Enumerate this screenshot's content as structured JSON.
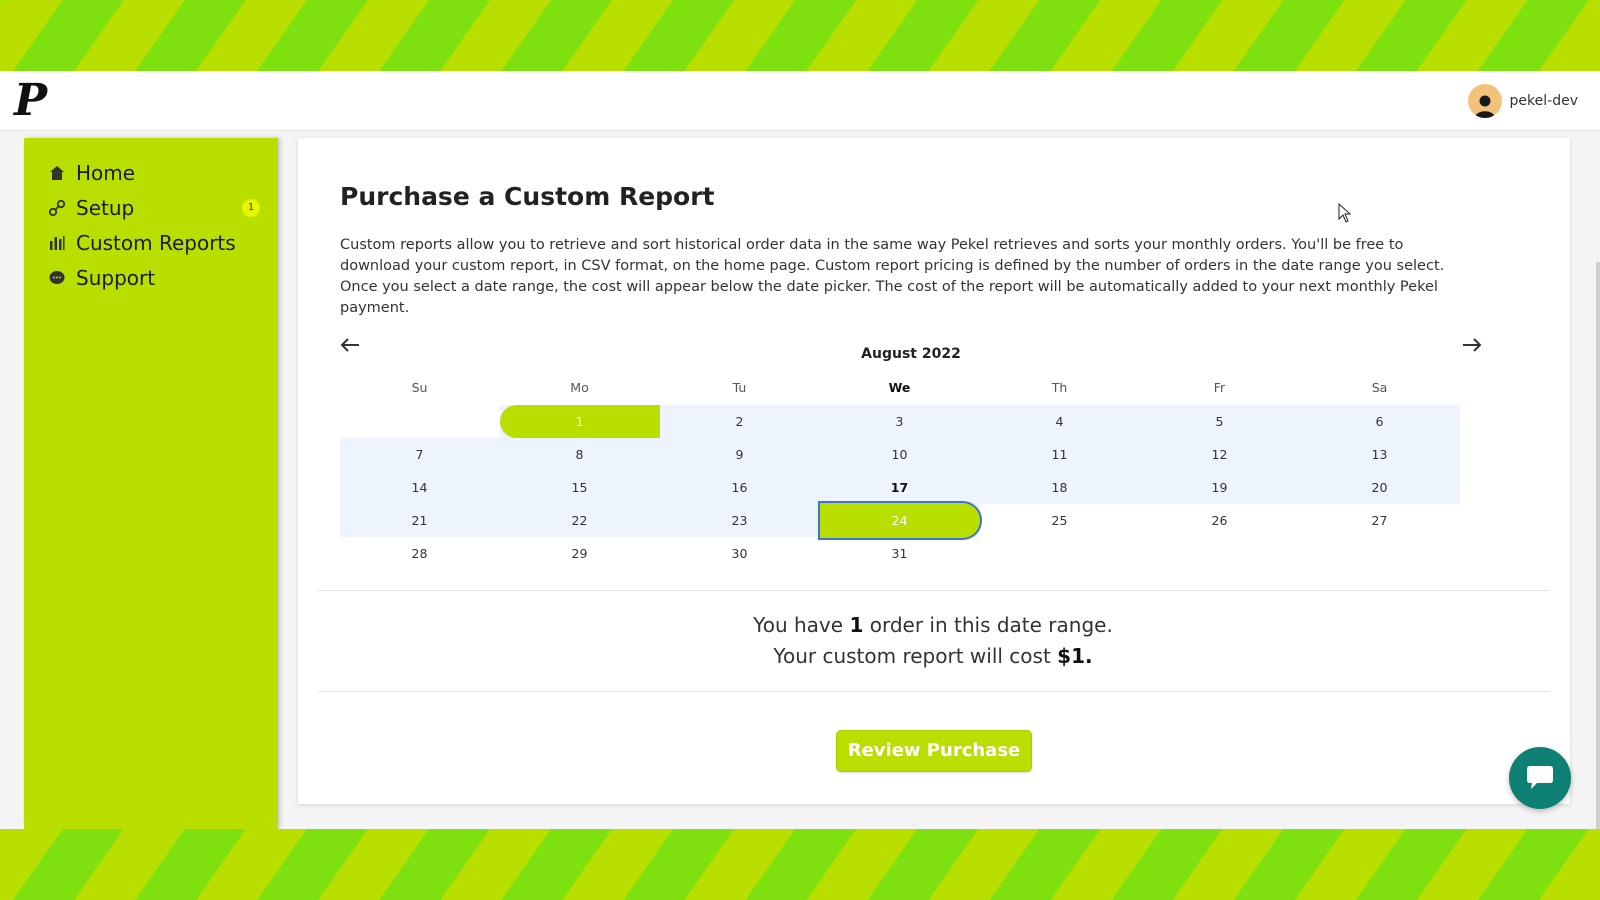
{
  "header": {
    "logo": "P",
    "username": "pekel-dev"
  },
  "sidebar": {
    "items": [
      {
        "label": "Home",
        "icon": "home-icon"
      },
      {
        "label": "Setup",
        "icon": "link-icon",
        "badge": "1"
      },
      {
        "label": "Custom Reports",
        "icon": "bar-chart-icon",
        "active": true
      },
      {
        "label": "Support",
        "icon": "chat-bubble-icon"
      }
    ]
  },
  "page": {
    "title": "Purchase a Custom Report",
    "description": "Custom reports allow you to retrieve and sort historical order data in the same way Pekel retrieves and sorts your monthly orders. You'll be free to download your custom report, in CSV format, on the home page. Custom report pricing is defined by the number of orders in the date range you select. Once you select a date range, the cost will appear below the date picker. The cost of the report will be automatically added to your next monthly Pekel payment."
  },
  "calendar": {
    "month_label": "August 2022",
    "prev_icon": "arrow-left-icon",
    "next_icon": "arrow-right-icon",
    "weekdays": [
      "Su",
      "Mo",
      "Tu",
      "We",
      "Th",
      "Fr",
      "Sa"
    ],
    "today_weekday": "We",
    "today": "17",
    "range_start": "1",
    "range_end": "24",
    "weeks": [
      [
        "",
        "1",
        "2",
        "3",
        "4",
        "5",
        "6"
      ],
      [
        "7",
        "8",
        "9",
        "10",
        "11",
        "12",
        "13"
      ],
      [
        "14",
        "15",
        "16",
        "17",
        "18",
        "19",
        "20"
      ],
      [
        "21",
        "22",
        "23",
        "24",
        "25",
        "26",
        "27"
      ],
      [
        "28",
        "29",
        "30",
        "31",
        "",
        "",
        ""
      ]
    ]
  },
  "summary": {
    "line1_pre": "You have ",
    "line1_count": "1",
    "line1_post": " order in this date range.",
    "line2_pre": "Your custom report will cost ",
    "line2_cost": "$1.",
    "line2_post": ""
  },
  "actions": {
    "review_label": "Review Purchase"
  },
  "colors": {
    "brand_lime": "#b9df00",
    "brand_green": "#7ee00f",
    "chat_teal": "#0e7f73",
    "range_band": "#eef4fd"
  }
}
